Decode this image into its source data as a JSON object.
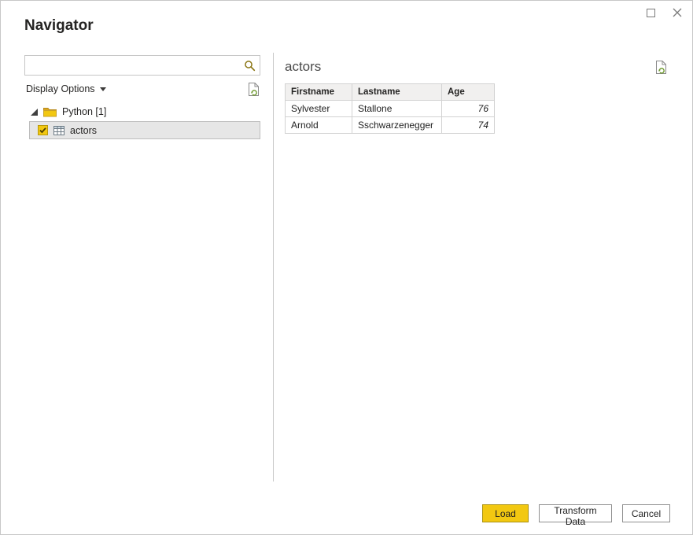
{
  "window": {
    "title": "Navigator"
  },
  "left_panel": {
    "search": {
      "value": ""
    },
    "display_options_label": "Display Options",
    "tree": {
      "folder_label": "Python [1]",
      "items": [
        {
          "label": "actors",
          "checked": true
        }
      ]
    }
  },
  "right_panel": {
    "title": "actors",
    "table": {
      "headers": [
        "Firstname",
        "Lastname",
        "Age"
      ],
      "rows": [
        [
          "Sylvester",
          "Stallone",
          "76"
        ],
        [
          "Arnold",
          "Sschwarzenegger",
          "74"
        ]
      ]
    }
  },
  "footer": {
    "load_label": "Load",
    "transform_label": "Transform Data",
    "cancel_label": "Cancel"
  },
  "colors": {
    "accent": "#F2C811",
    "selected_row_bg": "#E6E6E6"
  }
}
